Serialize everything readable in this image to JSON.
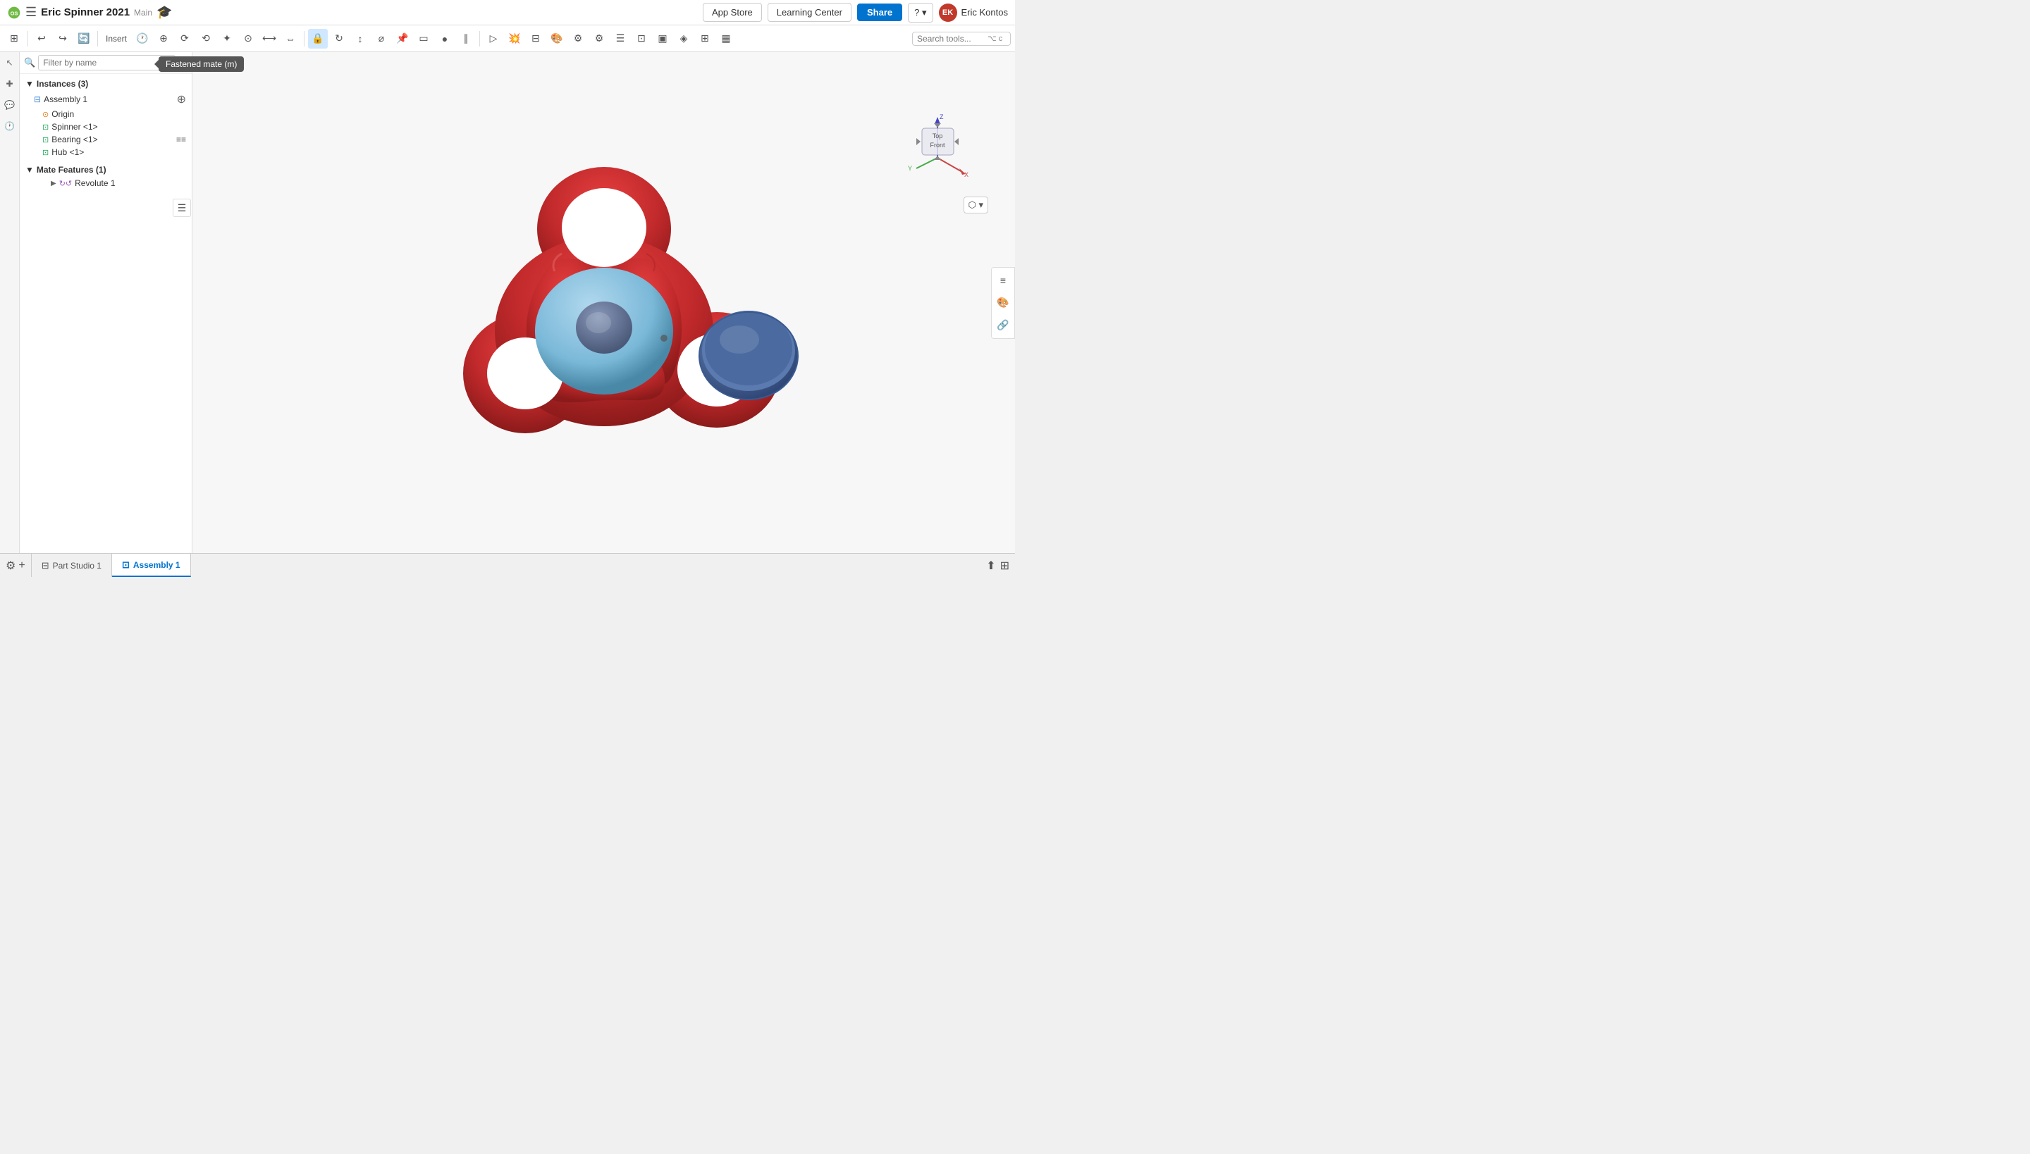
{
  "app": {
    "logo_text": "onshape",
    "doc_title": "Eric Spinner 2021",
    "branch": "Main",
    "tooltip_fastened_mate": "Fastened mate (m)"
  },
  "topbar": {
    "app_store_label": "App Store",
    "learning_center_label": "Learning Center",
    "share_label": "Share",
    "help_label": "?",
    "user_name": "Eric Kontos",
    "user_initials": "EK"
  },
  "toolbar": {
    "search_placeholder": "Search tools...",
    "undo_label": "↩",
    "redo_label": "↪"
  },
  "sidebar": {
    "filter_placeholder": "Filter by name",
    "instances_label": "Instances (3)",
    "assembly1_label": "Assembly 1",
    "origin_label": "Origin",
    "spinner_label": "Spinner <1>",
    "bearing_label": "Bearing <1>",
    "hub_label": "Hub <1>",
    "mate_features_label": "Mate Features (1)",
    "revolute_label": "Revolute 1"
  },
  "tabs": {
    "part_studio_label": "Part Studio 1",
    "assembly_label": "Assembly 1"
  },
  "nav_cube": {
    "top_label": "Top",
    "front_label": "Front"
  }
}
